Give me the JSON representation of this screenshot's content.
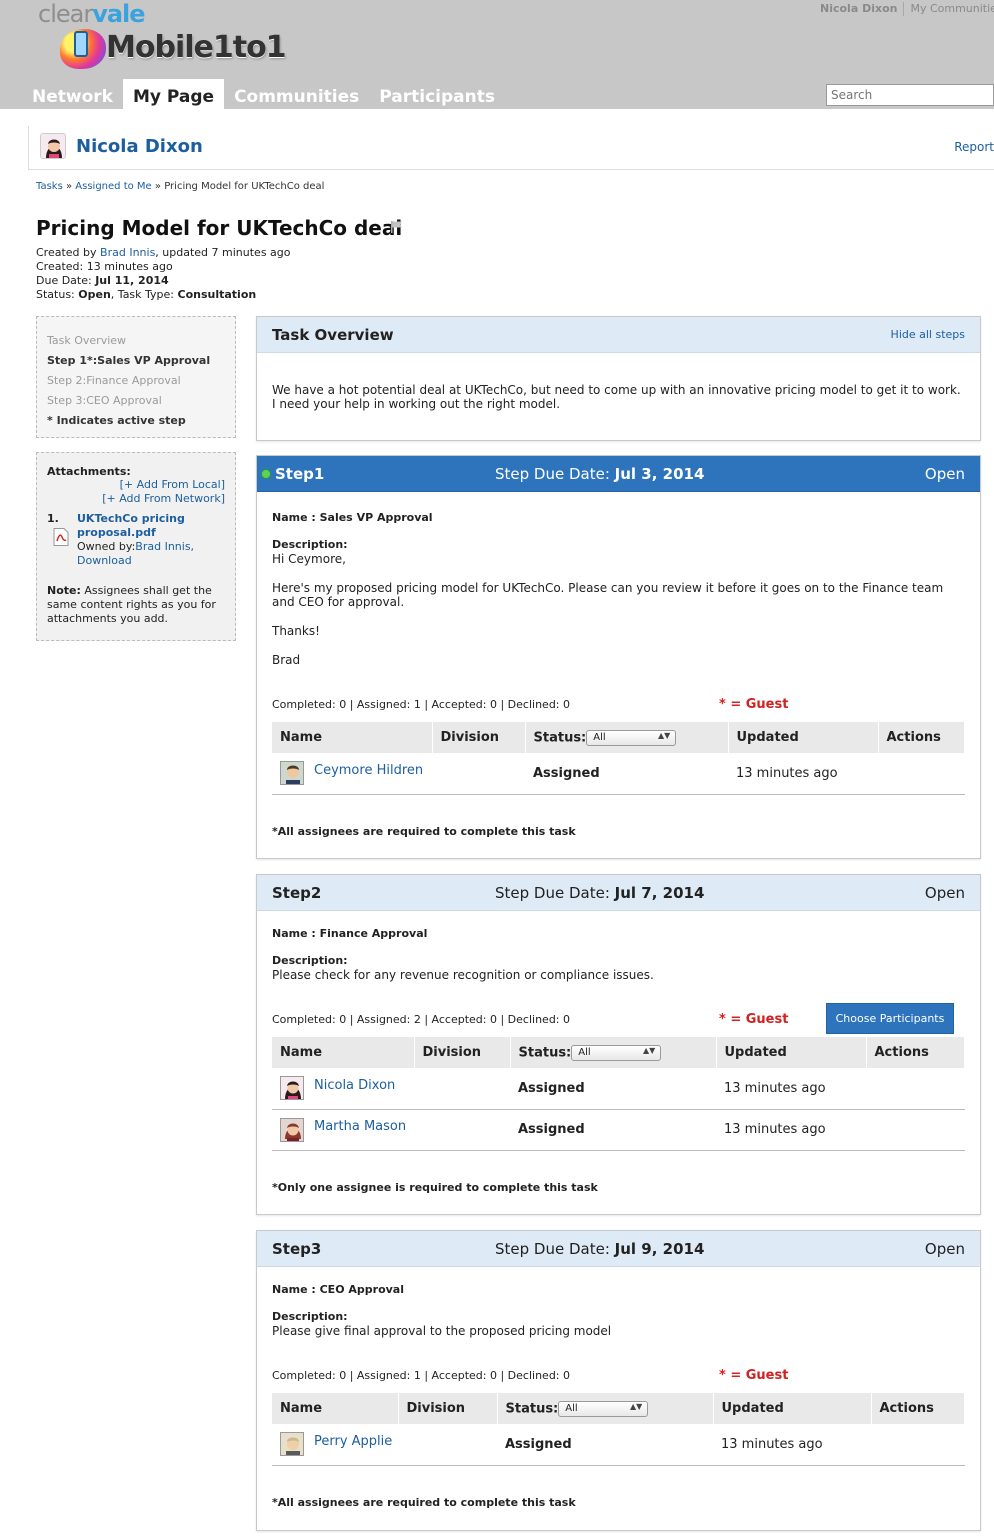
{
  "brand": {
    "clear": "clear",
    "vale": "vale",
    "mobile": "Mobile1to1"
  },
  "top_links": {
    "user": "Nicola Dixon",
    "communities": "My Communities"
  },
  "nav": {
    "network": "Network",
    "my_page": "My Page",
    "communities": "Communities",
    "participants": "Participants"
  },
  "search": {
    "placeholder": "Search"
  },
  "profile": {
    "name": "Nicola Dixon",
    "report": "Report"
  },
  "breadcrumb": {
    "tasks": "Tasks",
    "assigned_to_me": "Assigned to Me",
    "current": "Pricing Model for UKTechCo deal",
    "sep": "»"
  },
  "task": {
    "title": "Pricing Model for UKTechCo deal",
    "created_by_label": "Created by",
    "created_by": "Brad Innis",
    "updated": ", updated 7 minutes ago",
    "created": "Created: 13 minutes ago",
    "due_label": "Due Date:",
    "due_date": "Jul 11, 2014",
    "status_label": "Status:",
    "status": "Open",
    "type_label": ", Task Type:",
    "type": "Consultation"
  },
  "steps_nav": {
    "overview": "Task Overview",
    "step1": "Step 1*:Sales VP Approval",
    "step2": "Step 2:Finance Approval",
    "step3": "Step 3:CEO Approval",
    "indicates": "* Indicates active step"
  },
  "attachments": {
    "title": "Attachments:",
    "add_local": "[+ Add From Local]",
    "add_network": "[+ Add From Network]",
    "item_num": "1.",
    "file_name_1": "UKTechCo pricing",
    "file_name_2": "proposal.pdf",
    "owned_by": "Owned by:",
    "owner": "Brad Innis,",
    "download": "Download",
    "note_label": "Note:",
    "note": " Assignees shall get the same content rights as you for attachments you add."
  },
  "overview": {
    "title": "Task Overview",
    "hide_all": "Hide all steps",
    "text": "We have a hot potential deal at UKTechCo, but need to come up with an innovative pricing model to get it to work. I need your help in working out the right model."
  },
  "labels": {
    "due": "Step Due Date:",
    "name_prefix": "Name : ",
    "description": "Description:",
    "guest": "* = Guest",
    "col_name": "Name",
    "col_division": "Division",
    "col_status": "Status:",
    "col_updated": "Updated",
    "col_actions": "Actions",
    "status_filter": "All",
    "choose": "Choose Participants"
  },
  "steps": [
    {
      "title": "Step1",
      "due": "Jul 3, 2014",
      "state": "Open",
      "name": "Sales VP Approval",
      "desc": [
        "Hi Ceymore,",
        "Here's my proposed pricing model for UKTechCo. Please can you review it before it goes on to the Finance team and CEO for approval.",
        "Thanks!",
        "Brad"
      ],
      "counts": "Completed: 0 | Assigned: 1 | Accepted: 0 | Declined: 0",
      "rows": [
        {
          "name": "Ceymore Hildren",
          "status": "Assigned",
          "updated": "13 minutes ago"
        }
      ],
      "req": "*All assignees are required to complete this task"
    },
    {
      "title": "Step2",
      "due": "Jul 7, 2014",
      "state": "Open",
      "name": "Finance Approval",
      "desc": [
        "Please check for any revenue recognition or compliance issues."
      ],
      "counts": "Completed: 0 | Assigned: 2 | Accepted: 0 | Declined: 0",
      "rows": [
        {
          "name": "Nicola Dixon",
          "status": "Assigned",
          "updated": "13 minutes ago"
        },
        {
          "name": "Martha Mason",
          "status": "Assigned",
          "updated": "13 minutes ago"
        }
      ],
      "req": "*Only one assignee is required to complete this task"
    },
    {
      "title": "Step3",
      "due": "Jul 9, 2014",
      "state": "Open",
      "name": "CEO Approval",
      "desc": [
        "Please give final approval to the proposed pricing model"
      ],
      "counts": "Completed: 0 | Assigned: 1 | Accepted: 0 | Declined: 0",
      "rows": [
        {
          "name": "Perry Applie",
          "status": "Assigned",
          "updated": "13 minutes ago"
        }
      ],
      "req": "*All assignees are required to complete this task"
    }
  ]
}
